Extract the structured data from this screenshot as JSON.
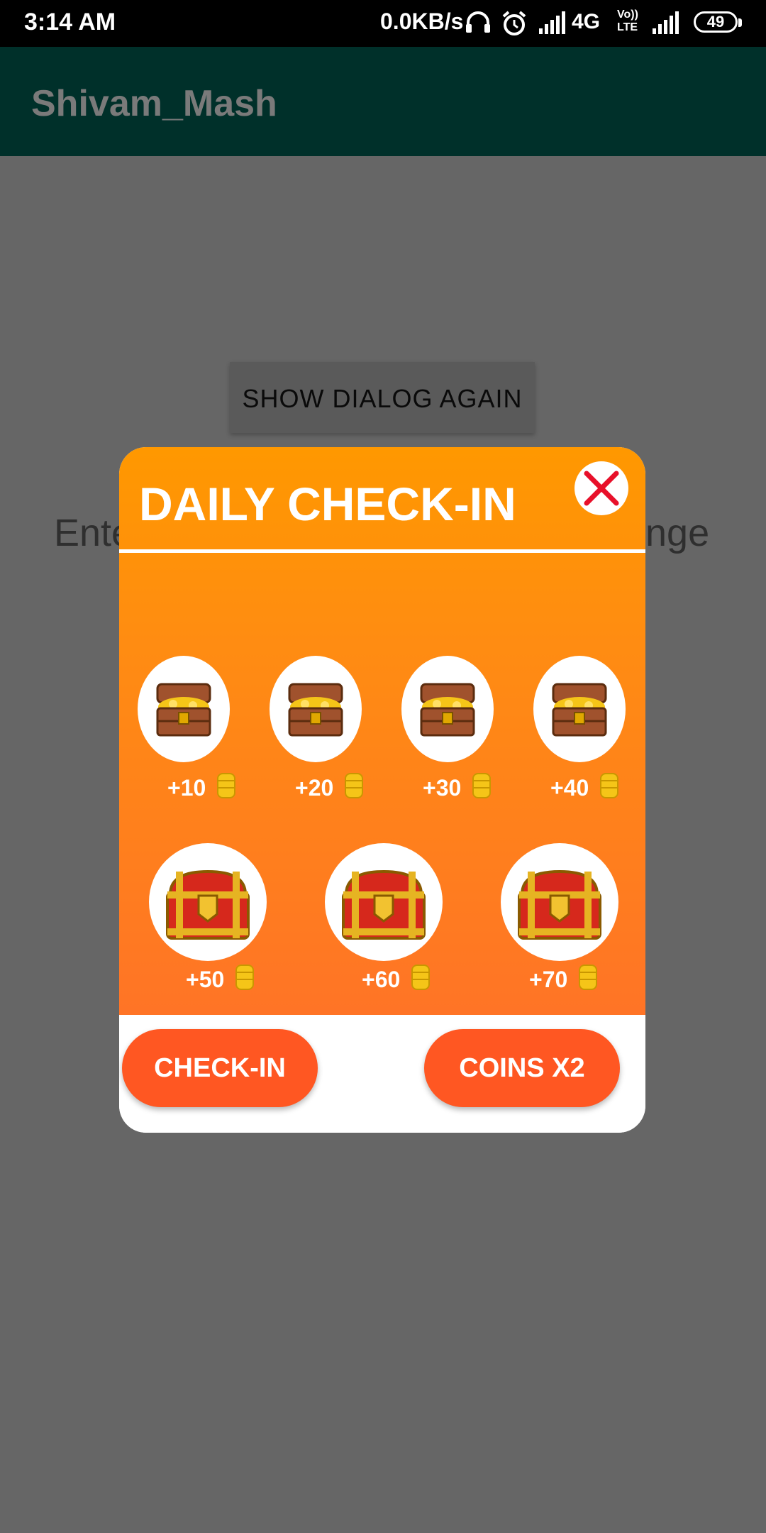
{
  "status_bar": {
    "time": "3:14 AM",
    "network_speed": "0.0KB/s",
    "network_type": "4G",
    "volte": "Vo)) LTE",
    "battery": "49",
    "icons": [
      "headset-icon",
      "alarm-icon",
      "signal-icon",
      "signal-icon-2"
    ]
  },
  "app_bar": {
    "title": "Shivam_Mash"
  },
  "background": {
    "show_dialog_button": "SHOW DIALOG AGAIN",
    "text_left": "Ente",
    "text_right": "nge"
  },
  "dialog": {
    "title": "DAILY CHECK-IN",
    "close_icon": "close-icon",
    "small_rewards": [
      {
        "amount": "+10",
        "icon": "gold-chest-icon"
      },
      {
        "amount": "+20",
        "icon": "gold-chest-icon"
      },
      {
        "amount": "+30",
        "icon": "gold-chest-icon"
      },
      {
        "amount": "+40",
        "icon": "gold-chest-icon"
      }
    ],
    "large_rewards": [
      {
        "amount": "+50",
        "icon": "red-chest-icon"
      },
      {
        "amount": "+60",
        "icon": "red-chest-icon"
      },
      {
        "amount": "+70",
        "icon": "red-chest-icon"
      }
    ],
    "check_in_button": "CHECK-IN",
    "coins_x2_button": "COINS X2",
    "colors": {
      "gradient_top": "#FF9800",
      "gradient_bottom": "#FF7426",
      "button": "#FF5722",
      "close_x": "#E8102A"
    }
  }
}
